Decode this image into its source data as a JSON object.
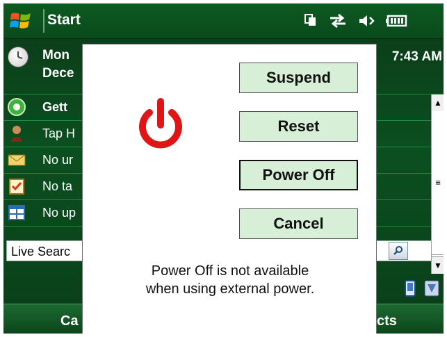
{
  "taskbar": {
    "start_label": "Start"
  },
  "today": {
    "date_line1": "Mon",
    "date_line2": "Dece",
    "time": "7:43 AM",
    "rows": [
      {
        "label": "Gett"
      },
      {
        "label": "Tap H"
      },
      {
        "label": "No ur"
      },
      {
        "label": "No ta"
      },
      {
        "label": "No up"
      }
    ],
    "search_text": "Live Searc"
  },
  "softkeys": {
    "left": "Ca",
    "right": "cts"
  },
  "dialog": {
    "buttons": [
      {
        "label": "Suspend"
      },
      {
        "label": "Reset"
      },
      {
        "label": "Power Off"
      },
      {
        "label": "Cancel"
      }
    ],
    "message_line1": "Power Off is not available",
    "message_line2": "when using external power."
  },
  "colors": {
    "dialog_button_bg": "#d7efd7",
    "power_icon": "#e01616",
    "theme_green": "#0b4f20"
  }
}
